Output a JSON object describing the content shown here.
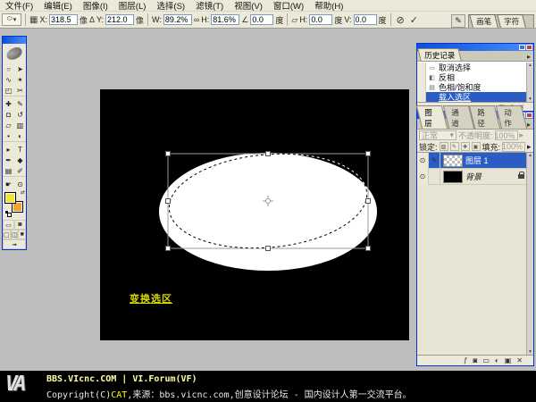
{
  "menubar": {
    "items": [
      {
        "label": "文件(F)"
      },
      {
        "label": "编辑(E)"
      },
      {
        "label": "图像(I)"
      },
      {
        "label": "图层(L)"
      },
      {
        "label": "选择(S)"
      },
      {
        "label": "滤镜(T)"
      },
      {
        "label": "视图(V)"
      },
      {
        "label": "窗口(W)"
      },
      {
        "label": "帮助(H)"
      }
    ]
  },
  "options": {
    "preset_glyph": "⬭",
    "preset_arrow": "▾",
    "ref_point_glyph": "▦",
    "x_label": "X:",
    "x_value": "318.5",
    "unit": "像",
    "relative_glyph": "Δ",
    "y_label": "Y:",
    "y_value": "212.0",
    "w_label": "W:",
    "w_value": "89.2%",
    "link_glyph": "∞",
    "h_label": "H:",
    "h_value": "81.6%",
    "rotate_glyph": "∠",
    "rot_value": "0.0",
    "deg": "度",
    "skew_glyph": "▱",
    "skew_h_label": "H:",
    "skew_h_value": "0.0",
    "skew_v_label": "V:",
    "skew_v_value": "0.0",
    "cancel_glyph": "⊘",
    "commit_glyph": "✓",
    "well_button_glyph": "✎",
    "well_tabs": [
      {
        "label": "画笔"
      },
      {
        "label": "字符"
      }
    ]
  },
  "toolbox": {
    "tools": [
      {
        "name": "elliptical-marquee",
        "glyph": "○"
      },
      {
        "name": "move",
        "glyph": "➤"
      },
      {
        "name": "lasso",
        "glyph": "∿"
      },
      {
        "name": "magic-wand",
        "glyph": "✶"
      },
      {
        "name": "crop",
        "glyph": "◰"
      },
      {
        "name": "slice",
        "glyph": "✂"
      },
      {
        "name": "healing-brush",
        "glyph": "✚"
      },
      {
        "name": "brush",
        "glyph": "✎"
      },
      {
        "name": "clone-stamp",
        "glyph": "◘"
      },
      {
        "name": "history-brush",
        "glyph": "↺"
      },
      {
        "name": "eraser",
        "glyph": "▱"
      },
      {
        "name": "gradient",
        "glyph": "▥"
      },
      {
        "name": "blur",
        "glyph": "•"
      },
      {
        "name": "dodge",
        "glyph": "◐"
      },
      {
        "name": "path-selection",
        "glyph": "▸"
      },
      {
        "name": "type",
        "glyph": "T"
      },
      {
        "name": "pen",
        "glyph": "✒"
      },
      {
        "name": "custom-shape",
        "glyph": "◆"
      },
      {
        "name": "notes",
        "glyph": "▤"
      },
      {
        "name": "eyedropper",
        "glyph": "✐"
      },
      {
        "name": "hand",
        "glyph": "☛"
      },
      {
        "name": "zoom",
        "glyph": "⊙"
      }
    ],
    "foreground_color": "#f2e431",
    "background_color": "#f2a52e",
    "swap_glyph": "⇄",
    "mask_modes": [
      {
        "name": "standard-mode",
        "glyph": "▭"
      },
      {
        "name": "quick-mask-mode",
        "glyph": "◙"
      }
    ],
    "screen_modes": [
      {
        "name": "standard-screen",
        "glyph": "▢"
      },
      {
        "name": "full-screen-menu",
        "glyph": "◫"
      },
      {
        "name": "full-screen",
        "glyph": "■"
      }
    ],
    "imageready_glyph": "➟"
  },
  "canvas": {
    "annotation": "变换选区"
  },
  "history": {
    "title": "历史记录",
    "menu_arrow": "▸",
    "items": [
      {
        "label": "取消选择",
        "glyph": "▭"
      },
      {
        "label": "反相",
        "glyph": "◧"
      },
      {
        "label": "色相/饱和度",
        "glyph": "▤"
      },
      {
        "label": "载入选区",
        "glyph": "▫"
      }
    ],
    "buttons": [
      {
        "name": "new-document-from-state",
        "glyph": "▣"
      },
      {
        "name": "new-snapshot",
        "glyph": "◎"
      },
      {
        "name": "delete-state",
        "glyph": "✕"
      }
    ],
    "scroll_up": "▲",
    "scroll_down": "▼"
  },
  "layers": {
    "tabs": [
      {
        "label": "图层"
      },
      {
        "label": "通道"
      },
      {
        "label": "路径"
      },
      {
        "label": "动作"
      }
    ],
    "menu_arrow": "▸",
    "blend_mode": "正常",
    "blend_arrow": "▾",
    "opacity_label": "不透明度:",
    "opacity_value": "100%",
    "spin_arrow": "▸",
    "lock_label": "锁定:",
    "lock_buttons": [
      {
        "name": "lock-transparency",
        "glyph": "▨"
      },
      {
        "name": "lock-pixels",
        "glyph": "✎"
      },
      {
        "name": "lock-position",
        "glyph": "✚"
      },
      {
        "name": "lock-all",
        "glyph": "▣"
      }
    ],
    "fill_label": "填充:",
    "fill_value": "100%",
    "rows": [
      {
        "label": "图层 1",
        "eye": "⊙",
        "indicator": "✎"
      },
      {
        "label": "背景",
        "eye": "⊙",
        "indicator": ""
      }
    ],
    "buttons": [
      {
        "name": "layer-style",
        "glyph": "ƒ"
      },
      {
        "name": "add-layer-mask",
        "glyph": "◙"
      },
      {
        "name": "new-layer-set",
        "glyph": "▭"
      },
      {
        "name": "adjustment-layer",
        "glyph": "◐"
      },
      {
        "name": "new-layer",
        "glyph": "▣"
      },
      {
        "name": "delete-layer",
        "glyph": "✕"
      }
    ],
    "scroll_up": "▲",
    "scroll_down": "▼"
  },
  "footer": {
    "logo": "VA",
    "line1": "BBS.VIcnc.COM | VI.Forum(VF)",
    "copyright": "Copyright(C)",
    "author": "CAT",
    "rest": ",来源：bbs.vicnc.com,创意设计论坛 - 国内设计人第一交流平台。"
  }
}
